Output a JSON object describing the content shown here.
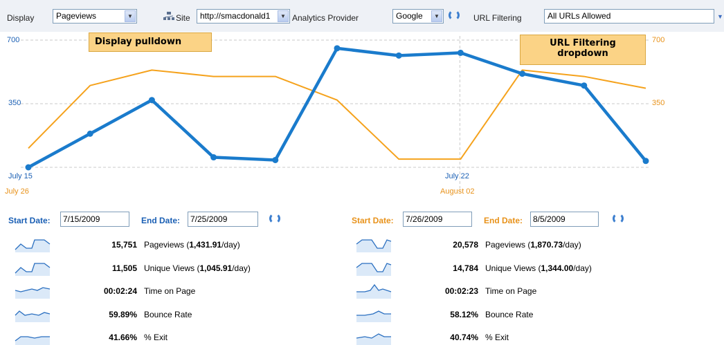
{
  "toolbar": {
    "display_label": "Display",
    "display_value": "Pageviews",
    "site_label": "Site",
    "site_value": "http://smacdonald1",
    "provider_label": "Analytics Provider",
    "provider_value": "Google",
    "url_filter_label": "URL Filtering",
    "url_filter_value": "All URLs Allowed"
  },
  "callouts": {
    "display": "Display pulldown",
    "url_filter_line1": "URL Filtering",
    "url_filter_line2": "dropdown"
  },
  "chart_data": {
    "type": "line",
    "y_ticks": {
      "left": [
        "700",
        "350"
      ],
      "right": [
        "700",
        "350"
      ]
    },
    "ylim": [
      0,
      700
    ],
    "x_labels_primary": [
      "July 15",
      "July 22"
    ],
    "x_labels_secondary": [
      "July 26",
      "August 02"
    ],
    "grid": true,
    "series": [
      {
        "color": "#1a7bcc",
        "values": [
          0,
          185,
          370,
          55,
          40,
          655,
          615,
          630,
          515,
          450,
          35
        ]
      },
      {
        "color": "#f5a21c",
        "values": [
          105,
          450,
          535,
          500,
          500,
          370,
          45,
          45,
          535,
          500,
          435
        ]
      }
    ]
  },
  "left_panel": {
    "start_label": "Start Date:",
    "start_value": "7/15/2009",
    "end_label": "End Date:",
    "end_value": "7/25/2009",
    "accent": "#1a5fb4",
    "metrics": [
      {
        "value": "15,751",
        "label": "Pageviews (",
        "bold": "1,431.91",
        "suffix": "/day)"
      },
      {
        "value": "11,505",
        "label": "Unique Views (",
        "bold": "1,045.91",
        "suffix": "/day)"
      },
      {
        "value": "00:02:24",
        "label": "Time on Page",
        "bold": "",
        "suffix": ""
      },
      {
        "value": "59.89%",
        "label": "Bounce Rate",
        "bold": "",
        "suffix": ""
      },
      {
        "value": "41.66%",
        "label": "% Exit",
        "bold": "",
        "suffix": ""
      }
    ]
  },
  "right_panel": {
    "start_label": "Start Date:",
    "start_value": "7/26/2009",
    "end_label": "End Date:",
    "end_value": "8/5/2009",
    "accent": "#e8921a",
    "metrics": [
      {
        "value": "20,578",
        "label": "Pageviews (",
        "bold": "1,870.73",
        "suffix": "/day)"
      },
      {
        "value": "14,784",
        "label": "Unique Views (",
        "bold": "1,344.00",
        "suffix": "/day)"
      },
      {
        "value": "00:02:23",
        "label": "Time on Page",
        "bold": "",
        "suffix": ""
      },
      {
        "value": "58.12%",
        "label": "Bounce Rate",
        "bold": "",
        "suffix": ""
      },
      {
        "value": "40.74%",
        "label": "% Exit",
        "bold": "",
        "suffix": ""
      }
    ]
  },
  "icons": [
    "site-icon",
    "refresh-icon",
    "dropdown-arrow-icon",
    "sparkline-icon"
  ]
}
